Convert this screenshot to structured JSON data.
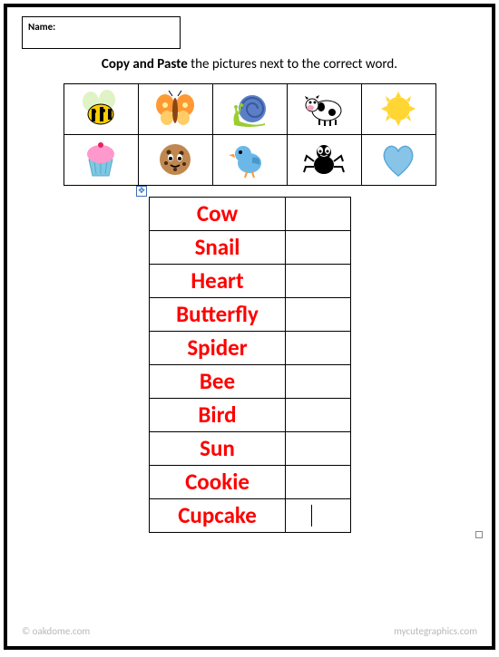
{
  "name_label": "Name:",
  "instruction_bold": "Copy and Paste",
  "instruction_rest": " the pictures next to the correct word.",
  "pictures": {
    "row1": [
      "bee",
      "butterfly",
      "snail",
      "cow",
      "sun"
    ],
    "row2": [
      "cupcake",
      "cookie",
      "bird",
      "spider",
      "heart"
    ]
  },
  "words": [
    "Cow",
    "Snail",
    "Heart",
    "Butterfly",
    "Spider",
    "Bee",
    "Bird",
    "Sun",
    "Cookie",
    "Cupcake"
  ],
  "footer_left": "© oakdome.com",
  "footer_right": "mycutegraphics.com"
}
